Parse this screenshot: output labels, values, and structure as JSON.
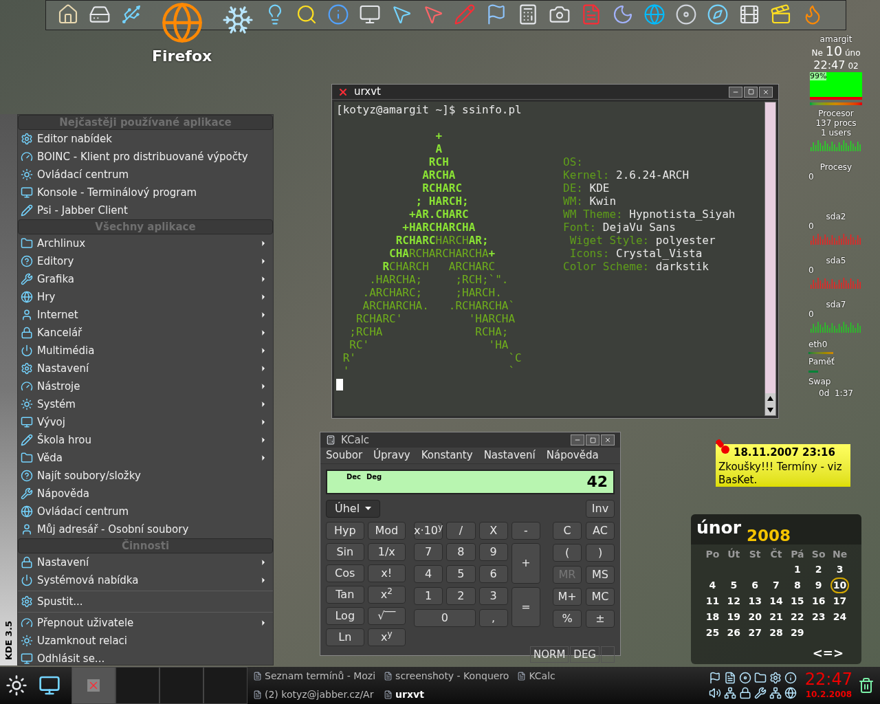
{
  "dock": {
    "label": "Firefox"
  },
  "start_menu": {
    "side_label": "KDE 3.5",
    "sections": [
      {
        "title": "Nejčastěji používané aplikace",
        "groups": [
          [
            {
              "label": "Editor nabídek",
              "submenu": false
            },
            {
              "label": "BOINC - Klient pro distribuované výpočty",
              "submenu": false
            },
            {
              "label": "Ovládací centrum",
              "submenu": false
            },
            {
              "label": "Konsole - Terminálový program",
              "submenu": false
            },
            {
              "label": "Psi - Jabber Client",
              "submenu": false
            }
          ]
        ]
      },
      {
        "title": "Všechny aplikace",
        "groups": [
          [
            {
              "label": "Archlinux",
              "submenu": true
            },
            {
              "label": "Editory",
              "submenu": true
            },
            {
              "label": "Grafika",
              "submenu": true
            },
            {
              "label": "Hry",
              "submenu": true
            },
            {
              "label": "Internet",
              "submenu": true
            },
            {
              "label": "Kancelář",
              "submenu": true
            },
            {
              "label": "Multimédia",
              "submenu": true
            },
            {
              "label": "Nastavení",
              "submenu": true
            },
            {
              "label": "Nástroje",
              "submenu": true
            },
            {
              "label": "Systém",
              "submenu": true
            },
            {
              "label": "Vývoj",
              "submenu": true
            },
            {
              "label": "Škola hrou",
              "submenu": true
            },
            {
              "label": "Věda",
              "submenu": true
            },
            {
              "label": "Najít soubory/složky",
              "submenu": false
            },
            {
              "label": "Nápověda",
              "submenu": false
            },
            {
              "label": "Ovládací centrum",
              "submenu": false
            },
            {
              "label": "Můj adresář - Osobní soubory",
              "submenu": false
            }
          ]
        ]
      },
      {
        "title": "Činnosti",
        "groups": [
          [
            {
              "label": "Nastavení",
              "submenu": true
            },
            {
              "label": "Systémová nabídka",
              "submenu": true
            }
          ],
          [
            {
              "label": "Spustit...",
              "submenu": false
            }
          ],
          [
            {
              "label": "Přepnout uživatele",
              "submenu": true
            },
            {
              "label": "Uzamknout relaci",
              "submenu": false
            },
            {
              "label": "Odhlásit se...",
              "submenu": false
            }
          ]
        ]
      }
    ]
  },
  "terminal": {
    "title": "urxvt",
    "prompt": "[kotyz@amargit ~]$ ssinfo.pl",
    "art": [
      [
        {
          "text": "               +",
          "bright": true
        }
      ],
      [
        {
          "text": "               A",
          "bright": true
        }
      ],
      [
        {
          "text": "              RCH",
          "bright": true
        }
      ],
      [
        {
          "text": "             ARCHA",
          "bright": true
        }
      ],
      [
        {
          "text": "             RCHARC",
          "bright": true
        }
      ],
      [
        {
          "text": "            ; HARCH;",
          "bright": true
        }
      ],
      [
        {
          "text": "           +AR.CHARC",
          "bright": true
        }
      ],
      [
        {
          "text": "          +HARCHARCHA",
          "bright": true
        }
      ],
      [
        {
          "text": "         RCHARC",
          "bright": true
        },
        {
          "text": "HARCH",
          "bright": false
        },
        {
          "text": "AR;",
          "bright": true
        }
      ],
      [
        {
          "text": "        CHA",
          "bright": true
        },
        {
          "text": "RCHARCHARCHA",
          "bright": false
        },
        {
          "text": "+",
          "bright": true
        }
      ],
      [
        {
          "text": "       R",
          "bright": true
        },
        {
          "text": "CHARCH   ARCHARC",
          "bright": false
        }
      ],
      [
        {
          "text": "     .HARCHA;     ;RCH;`\".",
          "bright": false
        }
      ],
      [
        {
          "text": "    .ARCHARC;     ;HARCH.",
          "bright": false
        }
      ],
      [
        {
          "text": "    ARCHARCHA.   .RCHARCHA`",
          "bright": false
        }
      ],
      [
        {
          "text": "   RCHARC'          'HARCHA",
          "bright": false
        }
      ],
      [
        {
          "text": "  ;RCHA              RCHA;",
          "bright": false
        }
      ],
      [
        {
          "text": "  RC'                  'HA",
          "bright": false
        }
      ],
      [
        {
          "text": " R'                       `C",
          "bright": false
        }
      ],
      [
        {
          "text": " '                        `",
          "bright": false
        }
      ]
    ],
    "info": [
      {
        "key": "OS:"
      },
      {
        "key": "Kernel:",
        "value": "2.6.24-ARCH"
      },
      {
        "key": "DE:",
        "value": "KDE"
      },
      {
        "key": "WM:",
        "value": "Kwin"
      },
      {
        "key": "WM Theme:",
        "value": "Hypnotista_Siyah"
      },
      {
        "key": "Font:",
        "value": "DejaVu Sans"
      },
      {
        "key": " Wiget Style:",
        "value": "polyester"
      },
      {
        "key": " Icons:",
        "value": "Crystal_Vista"
      },
      {
        "key": "Color Scheme:",
        "value": "darkstik"
      }
    ]
  },
  "calculator": {
    "title": "KCalc",
    "menu": [
      "Soubor",
      "Úpravy",
      "Konstanty",
      "Nastavení",
      "Nápověda"
    ],
    "modes": [
      "Dec",
      "Deg"
    ],
    "value": "42",
    "angle_button": "Úhel",
    "inv_button": "Inv",
    "function_keys": [
      "Hyp",
      "Mod",
      "Sin",
      "1/x",
      "Cos",
      "x!",
      "Tan",
      "x$^{2}$",
      "Log",
      "√‾‾",
      "Ln",
      "x$^{y}$"
    ],
    "number_pad": [
      {
        "label": "x·10$^{y}$",
        "kind": "key"
      },
      {
        "label": "/",
        "kind": "key"
      },
      {
        "label": "X",
        "kind": "key"
      },
      {
        "label": "-",
        "kind": "key"
      },
      {
        "label": "7",
        "kind": "key"
      },
      {
        "label": "8",
        "kind": "key"
      },
      {
        "label": "9",
        "kind": "key"
      },
      {
        "label": "+",
        "kind": "tall"
      },
      {
        "label": "4",
        "kind": "key"
      },
      {
        "label": "5",
        "kind": "key"
      },
      {
        "label": "6",
        "kind": "key"
      },
      {
        "label": "1",
        "kind": "key"
      },
      {
        "label": "2",
        "kind": "key"
      },
      {
        "label": "3",
        "kind": "key"
      },
      {
        "label": "=",
        "kind": "tall"
      },
      {
        "label": "0",
        "kind": "wide"
      },
      {
        "label": ",",
        "kind": "key"
      }
    ],
    "memory_keys": [
      {
        "label": "C",
        "disabled": false
      },
      {
        "label": "AC",
        "disabled": false
      },
      {
        "label": "(",
        "disabled": false
      },
      {
        "label": ")",
        "disabled": false
      },
      {
        "label": "MR",
        "disabled": true
      },
      {
        "label": "MS",
        "disabled": false
      },
      {
        "label": "M+",
        "disabled": false
      },
      {
        "label": "MC",
        "disabled": false
      },
      {
        "label": "%",
        "disabled": false
      },
      {
        "label": "±",
        "disabled": false
      }
    ],
    "status": [
      "NORM",
      "DEG"
    ]
  },
  "system_monitor": {
    "host": "amargit",
    "day": "Ne",
    "date": "10",
    "month": "úno",
    "time": "22:47",
    "seconds": "02",
    "cpu_reading": "99%",
    "cpu_label": "Procesor",
    "procs": "137 procs",
    "users": "1 users",
    "disks": [
      {
        "label": "Procesy",
        "reading": "0"
      },
      {
        "label": "sda2",
        "reading": "0"
      },
      {
        "label": "sda5",
        "reading": "0"
      },
      {
        "label": "sda7",
        "reading": "0"
      }
    ],
    "net_label": "eth0",
    "memory_label": "Paměť",
    "swap_label": "Swap",
    "uptime": "0d  1:37"
  },
  "note": {
    "title": "18.11.2007 23:16",
    "text": "Zkoušky!!! Termíny - viz BasKet."
  },
  "calendar": {
    "month": "únor",
    "year": "2008",
    "weekdays": [
      "Po",
      "Út",
      "St",
      "Čt",
      "Pá",
      "So",
      "Ne"
    ],
    "weeks": [
      {
        "padded": true,
        "days": [
          {
            "day": "1",
            "selected": false
          },
          {
            "day": "2",
            "selected": false
          },
          {
            "day": "3",
            "selected": false
          }
        ]
      },
      {
        "days": [
          {
            "day": "4",
            "selected": false
          },
          {
            "day": "5",
            "selected": false
          },
          {
            "day": "6",
            "selected": false
          },
          {
            "day": "7",
            "selected": false
          },
          {
            "day": "8",
            "selected": false
          },
          {
            "day": "9",
            "selected": false
          },
          {
            "day": "10",
            "selected": true
          }
        ]
      },
      {
        "days": [
          {
            "day": "11",
            "selected": false
          },
          {
            "day": "12",
            "selected": false
          },
          {
            "day": "13",
            "selected": false
          },
          {
            "day": "14",
            "selected": false
          },
          {
            "day": "15",
            "selected": false
          },
          {
            "day": "16",
            "selected": false
          },
          {
            "day": "17",
            "selected": false
          }
        ]
      },
      {
        "days": [
          {
            "day": "18",
            "selected": false
          },
          {
            "day": "19",
            "selected": false
          },
          {
            "day": "20",
            "selected": false
          },
          {
            "day": "21",
            "selected": false
          },
          {
            "day": "22",
            "selected": false
          },
          {
            "day": "23",
            "selected": false
          },
          {
            "day": "24",
            "selected": false
          }
        ]
      },
      {
        "days": [
          {
            "day": "25",
            "selected": false
          },
          {
            "day": "26",
            "selected": false
          },
          {
            "day": "27",
            "selected": false
          },
          {
            "day": "28",
            "selected": false
          },
          {
            "day": "29",
            "selected": false
          }
        ]
      }
    ],
    "nav": "<=>"
  },
  "taskbar": {
    "pager": [
      {
        "selected": true
      },
      {
        "selected": false
      },
      {
        "selected": false
      },
      {
        "selected": false
      }
    ],
    "tasks": [
      {
        "label": "Seznam termínů - Mozi",
        "active": false
      },
      {
        "label": "screenshoty - Konquero",
        "active": false
      },
      {
        "label": "KCalc",
        "active": false
      },
      {
        "label": "(2) kotyz@jabber.cz/Ar",
        "active": false
      },
      {
        "label": "urxvt",
        "active": true
      }
    ],
    "clock": "22:47",
    "date": "10.2.2008"
  }
}
